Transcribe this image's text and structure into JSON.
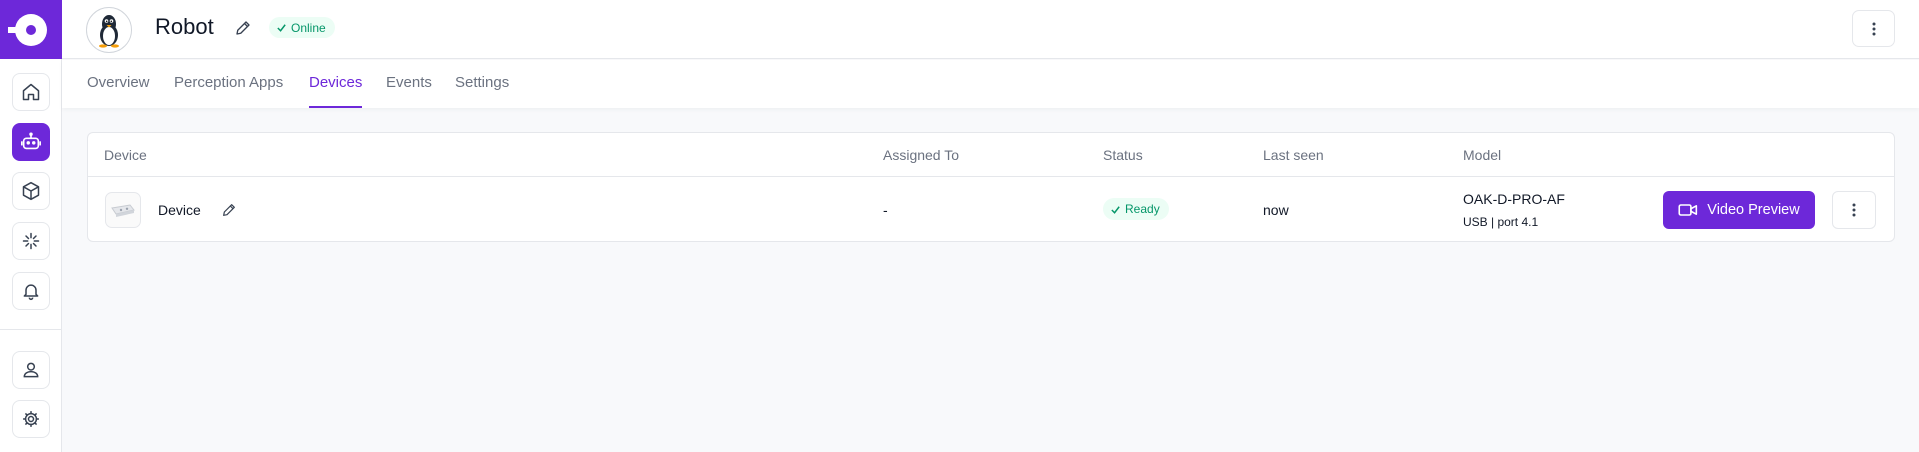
{
  "sidebar": {
    "items": [
      {
        "icon": "home-icon"
      },
      {
        "icon": "robot-icon",
        "active": true
      },
      {
        "icon": "cube-icon"
      },
      {
        "icon": "sparkle-icon"
      },
      {
        "icon": "bell-icon"
      },
      {
        "icon": "user-icon"
      },
      {
        "icon": "gear-icon"
      }
    ]
  },
  "header": {
    "robot_name": "Robot",
    "status": "Online"
  },
  "tabs": [
    "Overview",
    "Perception Apps",
    "Devices",
    "Events",
    "Settings"
  ],
  "active_tab": "Devices",
  "table": {
    "headers": {
      "device": "Device",
      "assigned_to": "Assigned To",
      "status": "Status",
      "last_seen": "Last seen",
      "model": "Model"
    },
    "rows": [
      {
        "device": "Device",
        "assigned_to": "-",
        "status": "Ready",
        "last_seen": "now",
        "model": "OAK-D-PRO-AF",
        "connection": "USB | port 4.1",
        "action": "Video Preview"
      }
    ]
  },
  "colors": {
    "accent": "#6d28d9",
    "success_text": "#059669",
    "success_bg": "#ecfdf5"
  }
}
